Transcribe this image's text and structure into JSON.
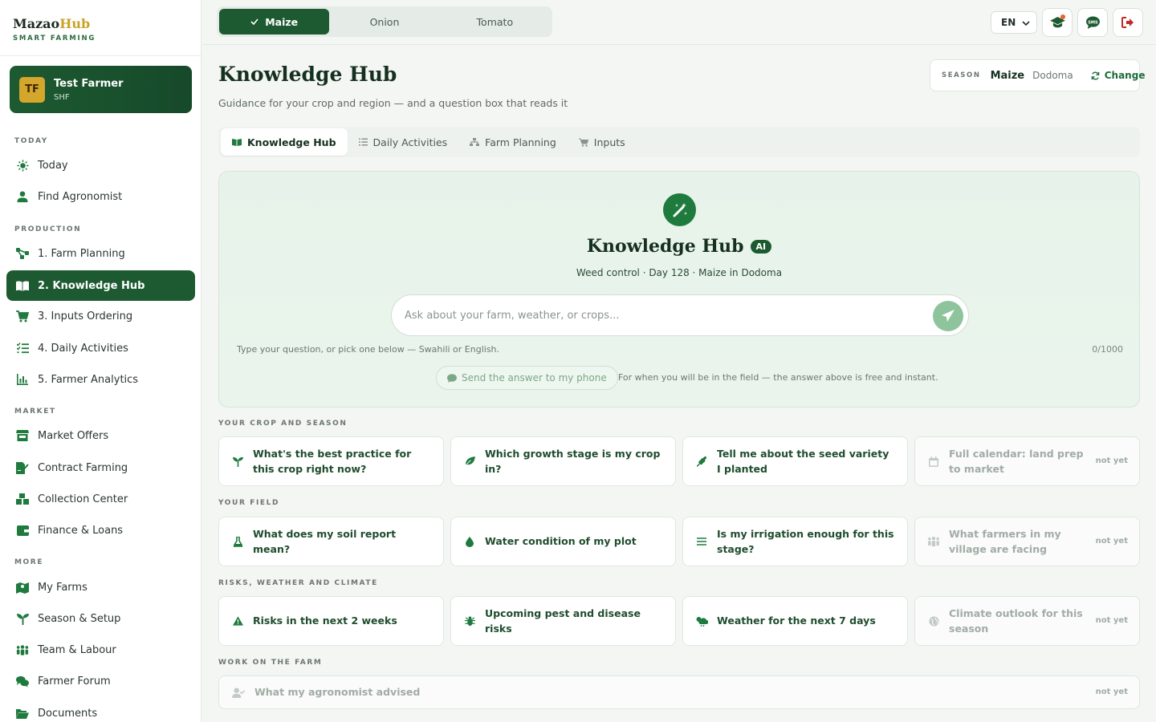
{
  "brand": {
    "name_a": "Mazao",
    "name_b": "Hub",
    "subtitle": "SMART FARMING"
  },
  "user": {
    "initials": "TF",
    "name": "Test Farmer",
    "role": "SHF"
  },
  "nav": {
    "today_section": "TODAY",
    "today": "Today",
    "find_agronomist": "Find Agronomist",
    "production_section": "PRODUCTION",
    "farm_planning": "1. Farm Planning",
    "knowledge_hub": "2. Knowledge Hub",
    "inputs_ordering": "3. Inputs Ordering",
    "daily_activities": "4. Daily Activities",
    "farmer_analytics": "5. Farmer Analytics",
    "market_section": "MARKET",
    "market_offers": "Market Offers",
    "contract_farming": "Contract Farming",
    "collection_center": "Collection Center",
    "finance_loans": "Finance & Loans",
    "more_section": "MORE",
    "my_farms": "My Farms",
    "season_setup": "Season & Setup",
    "team_labour": "Team & Labour",
    "farmer_forum": "Farmer Forum",
    "documents": "Documents"
  },
  "topbar": {
    "crops": [
      "Maize",
      "Onion",
      "Tomato"
    ],
    "active_crop": "Maize",
    "language": "EN"
  },
  "page": {
    "title": "Knowledge Hub",
    "subtitle": "Guidance for your crop and region — and a question box that reads it"
  },
  "season": {
    "label": "SEASON",
    "crop": "Maize",
    "region": "Dodoma",
    "change": "Change"
  },
  "subtabs": [
    "Knowledge Hub",
    "Daily Activities",
    "Farm Planning",
    "Inputs"
  ],
  "hero": {
    "title": "Knowledge Hub",
    "badge": "AI",
    "context": "Weed control · Day 128 · Maize in Dodoma",
    "placeholder": "Ask about your farm, weather, or crops...",
    "hint": "Type your question, or pick one below — Swahili or English.",
    "counter": "0/1000",
    "sms_button": "Send the answer to my phone",
    "sms_note": "For when you will be in the field — the answer above is free and instant."
  },
  "sections": {
    "crop": {
      "label": "YOUR CROP AND SEASON",
      "cards": [
        "What's the best practice for this crop right now?",
        "Which growth stage is my crop in?",
        "Tell me about the seed variety I planted",
        "Full calendar: land prep to market"
      ]
    },
    "field": {
      "label": "YOUR FIELD",
      "cards": [
        "What does my soil report mean?",
        "Water condition of my plot",
        "Is my irrigation enough for this stage?",
        "What farmers in my village are facing"
      ]
    },
    "risks": {
      "label": "RISKS, WEATHER AND CLIMATE",
      "cards": [
        "Risks in the next 2 weeks",
        "Upcoming pest and disease risks",
        "Weather for the next 7 days",
        "Climate outlook for this season"
      ]
    },
    "work": {
      "label": "WORK ON THE FARM",
      "cards": [
        "What my agronomist advised"
      ]
    }
  },
  "not_yet": "not yet",
  "colors": {
    "brand_green": "#1d5a31",
    "accent_gold": "#c9a227",
    "alert": "#e8632b"
  }
}
